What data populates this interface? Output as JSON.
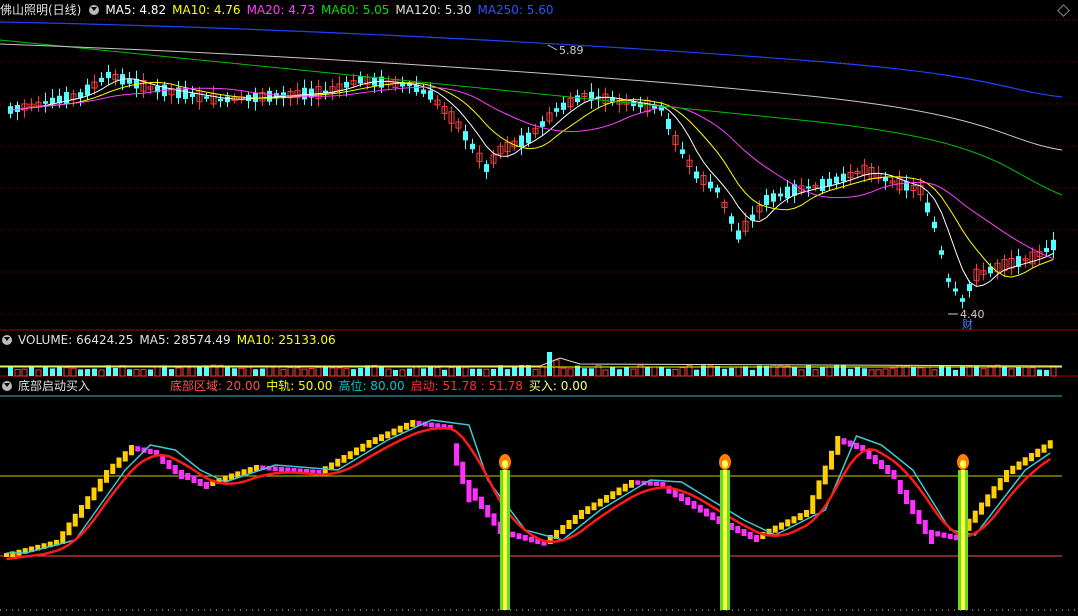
{
  "stock_title": "佛山照明(日线)",
  "ma_legend": [
    {
      "label": "MA5: 4.82",
      "color": "#ffffff"
    },
    {
      "label": "MA10: 4.76",
      "color": "#ffff00"
    },
    {
      "label": "MA20: 4.73",
      "color": "#ff40ff"
    },
    {
      "label": "MA60: 5.05",
      "color": "#00e000"
    },
    {
      "label": "MA120: 5.30",
      "color": "#e0e0e0"
    },
    {
      "label": "MA250: 5.60",
      "color": "#3050ff"
    }
  ],
  "price_annotations": {
    "high": "5.89",
    "low": "4.40",
    "badge": "财"
  },
  "volume_legend": [
    {
      "label": "VOLUME: 66424.25",
      "color": "#e0e0e0"
    },
    {
      "label": "MA5: 28574.49",
      "color": "#e0e0e0"
    },
    {
      "label": "MA10: 25133.06",
      "color": "#ffff00"
    }
  ],
  "indicator_title": "底部启动买入",
  "indicator_legend": [
    {
      "label": "底部区域: 20.00",
      "color": "#ff5050"
    },
    {
      "label": "中轨: 50.00",
      "color": "#ffff00"
    },
    {
      "label": "高位: 80.00",
      "color": "#00c8c8"
    },
    {
      "label": "启动: 51.78 : 51.78",
      "color": "#ff3030"
    },
    {
      "label": "买入: 0.00",
      "color": "#ffff80"
    }
  ],
  "colors": {
    "up": "#ff3c3c",
    "down": "#54ffff",
    "grid": "#a00000",
    "ma5": "#ffffff",
    "ma10": "#ffff00",
    "ma20": "#ff40ff",
    "ma60": "#00c000",
    "ma120": "#c8c8c8",
    "ma250": "#2040ff"
  },
  "icons": [
    "circle-collapse-icon",
    "diamond-icon",
    "flame-icon"
  ]
}
